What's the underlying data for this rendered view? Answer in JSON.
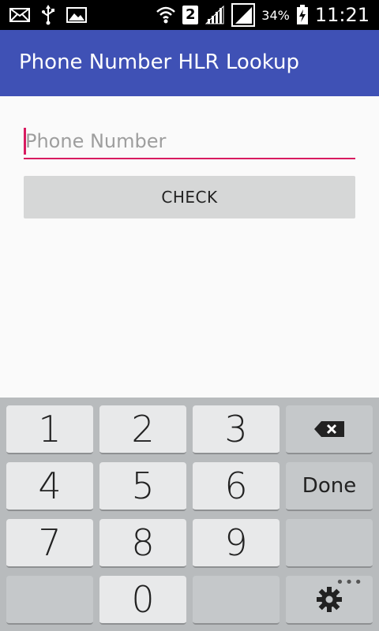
{
  "status_bar": {
    "network_badge": "2",
    "battery": "34%",
    "time": "11:21",
    "icons": [
      "mail-icon",
      "usb-icon",
      "image-icon",
      "wifi-icon",
      "signal-icon",
      "signal-icon",
      "battery-charging-icon"
    ]
  },
  "appbar": {
    "title": "Phone Number HLR Lookup",
    "color": "#3f51b5"
  },
  "form": {
    "phone_placeholder": "Phone Number",
    "phone_value": "",
    "check_label": "CHECK",
    "accent": "#d81b60"
  },
  "keyboard": {
    "keys": [
      "1",
      "2",
      "3",
      "4",
      "5",
      "6",
      "7",
      "8",
      "9",
      "0"
    ],
    "done_label": "Done",
    "backspace_icon": "backspace-icon",
    "settings_icon": "gear-icon",
    "more_icon": "more-dots-icon",
    "more_label": "•••"
  }
}
